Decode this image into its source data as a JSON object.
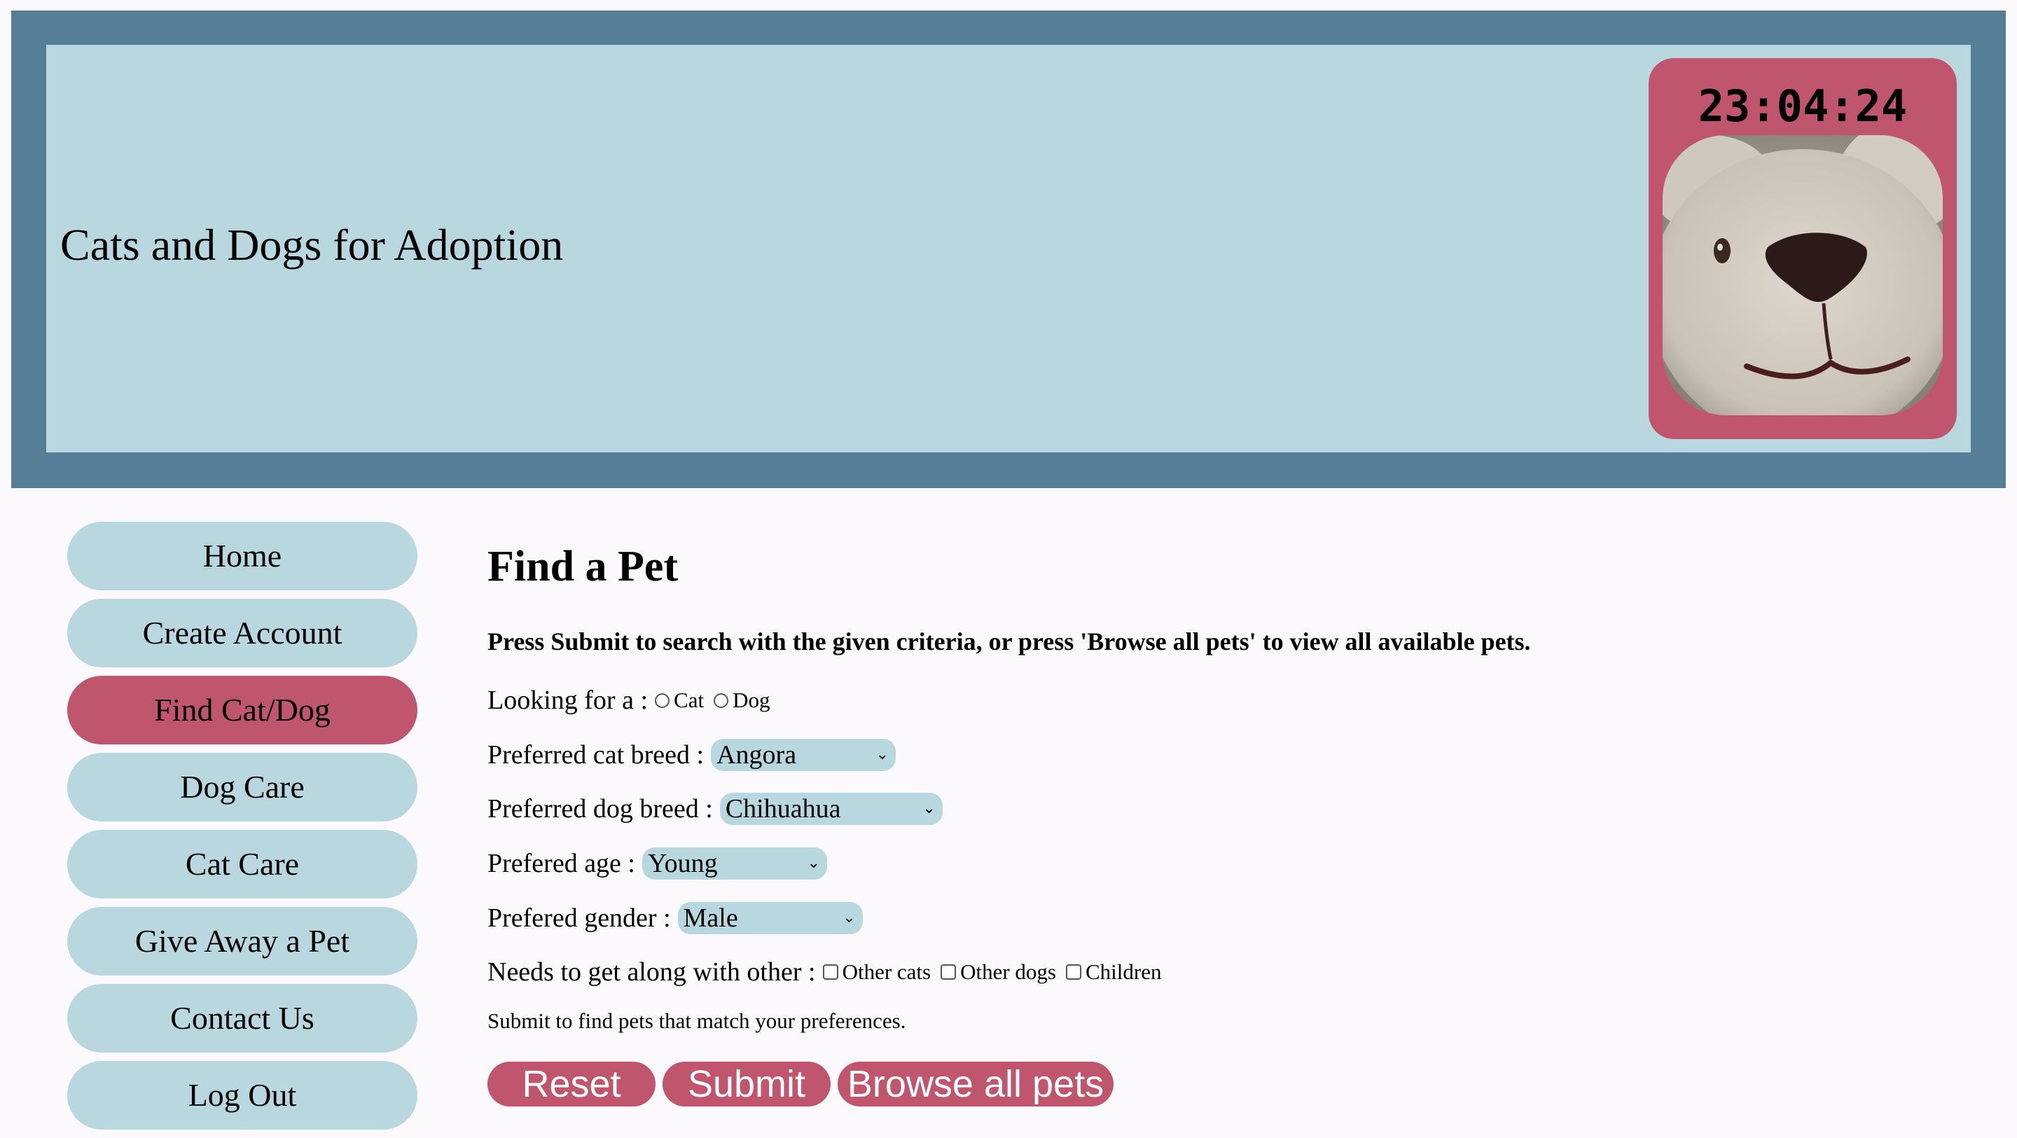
{
  "header": {
    "site_title": "Cats and Dogs for Adoption",
    "clock": "23:04:24"
  },
  "nav": {
    "items": [
      {
        "label": "Home",
        "active": false
      },
      {
        "label": "Create Account",
        "active": false
      },
      {
        "label": "Find Cat/Dog",
        "active": true
      },
      {
        "label": "Dog Care",
        "active": false
      },
      {
        "label": "Cat Care",
        "active": false
      },
      {
        "label": "Give Away a Pet",
        "active": false
      },
      {
        "label": "Contact Us",
        "active": false
      },
      {
        "label": "Log Out",
        "active": false
      }
    ]
  },
  "main": {
    "title": "Find a Pet",
    "instructions": "Press Submit to search with the given criteria, or press 'Browse all pets' to view all available pets.",
    "looking_for": {
      "label": "Looking for a :",
      "options": [
        "Cat",
        "Dog"
      ]
    },
    "cat_breed": {
      "label": "Preferred cat breed :",
      "value": "Angora"
    },
    "dog_breed": {
      "label": "Preferred dog breed :",
      "value": "Chihuahua"
    },
    "age": {
      "label": "Prefered age :",
      "value": "Young"
    },
    "gender": {
      "label": "Prefered gender :",
      "value": "Male"
    },
    "gets_along": {
      "label": "Needs to get along with other :",
      "options": [
        "Other cats",
        "Other dogs",
        "Children"
      ]
    },
    "hint": "Submit to find pets that match your preferences.",
    "buttons": {
      "reset": "Reset",
      "submit": "Submit",
      "browse": "Browse all pets"
    }
  },
  "colors": {
    "header_frame": "#577e97",
    "header_bg": "#b9d7df",
    "accent": "#c0566d",
    "page_bg": "#fcf9fd"
  },
  "icons": {
    "select_arrow": "chevron-down-icon",
    "header_image": "plush-dog-photo"
  }
}
